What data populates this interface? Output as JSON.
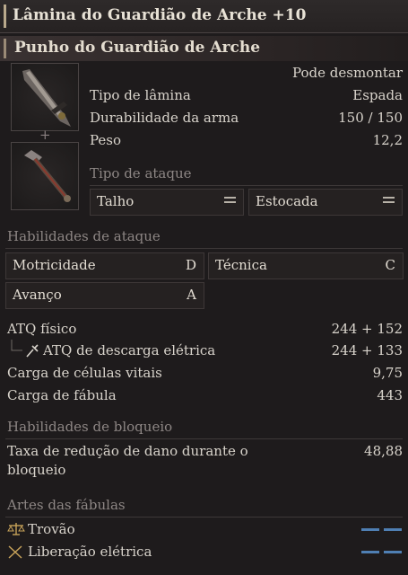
{
  "title": "Lâmina do Guardião de Arche +10",
  "subtitle": "Punho do Guardião de Arche",
  "dismantle": "Pode desmontar",
  "stats": [
    {
      "label": "Tipo de lâmina",
      "value": "Espada"
    },
    {
      "label": "Durabilidade da arma",
      "value": "150 / 150"
    },
    {
      "label": "Peso",
      "value": "12,2"
    }
  ],
  "attack_type": {
    "label": "Tipo de ataque",
    "options": [
      "Talho",
      "Estocada"
    ]
  },
  "attack_abilities": {
    "label": "Habilidades de ataque",
    "items": [
      {
        "label": "Motricidade",
        "grade": "D"
      },
      {
        "label": "Técnica",
        "grade": "C"
      },
      {
        "label": "Avanço",
        "grade": "A"
      }
    ]
  },
  "attack": {
    "physical_label": "ATQ físico",
    "physical_value": "244 + 152",
    "electric_label": "ATQ de descarga elétrica",
    "electric_value": "244 + 133",
    "vital_cells_label": "Carga de células vitais",
    "vital_cells_value": "9,75",
    "fable_label": "Carga de fábula",
    "fable_value": "443"
  },
  "block": {
    "label": "Habilidades de bloqueio",
    "reduction_label_line1": "Taxa de redução de dano durante o",
    "reduction_label_line2": "bloqueio",
    "reduction_value": "48,88"
  },
  "fable_arts": {
    "label": "Artes das fábulas",
    "items": [
      {
        "label": "Trovão",
        "icon": "scales-icon"
      },
      {
        "label": "Liberação elétrica",
        "icon": "crossed-swords-icon"
      }
    ]
  },
  "colors": {
    "accent_blue": "#4f7fb3",
    "background": "#1e1b1c"
  }
}
